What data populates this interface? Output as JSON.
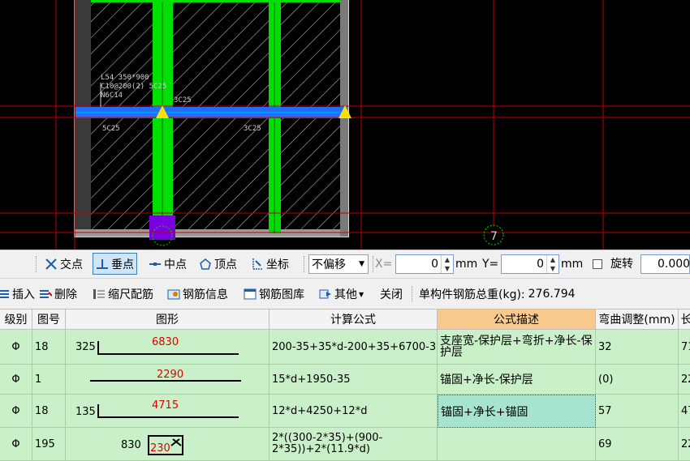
{
  "cad": {
    "beam_label_lines": [
      "L54 350*900",
      "C10@200(2) 5C25",
      "N6C14"
    ],
    "rebar_labels": [
      "3C25",
      "5C25",
      "3C25"
    ],
    "axis_label": "7"
  },
  "snap_toolbar": {
    "intersection": "交点",
    "perpendicular": "垂点",
    "midpoint": "中点",
    "vertex": "顶点",
    "coordinate": "坐标",
    "offset_mode": "不偏移",
    "x_label": "X=",
    "x_value": "0",
    "x_unit": "mm",
    "y_label": "Y=",
    "y_value": "0",
    "y_unit": "mm",
    "rotate_label": "旋转",
    "rotate_value": "0.000"
  },
  "rebar_toolbar": {
    "insert": "插入",
    "delete": "删除",
    "scale_rebar": "缩尺配筋",
    "rebar_info": "钢筋信息",
    "rebar_library": "钢筋图库",
    "other": "其他",
    "close": "关闭",
    "total_weight_label": "单构件钢筋总重(kg):",
    "total_weight_value": "276.794"
  },
  "table": {
    "columns": [
      "级别",
      "图号",
      "图形",
      "计算公式",
      "公式描述",
      "弯曲调整(mm)",
      "长"
    ],
    "selected_column": "公式描述",
    "rows": [
      {
        "grade": "Φ",
        "fig": "18",
        "shape_left": "325",
        "shape_len": "6830",
        "formula": "200-35+35*d-200+35+6700-35",
        "desc": "支座宽-保护层+弯折+净长-保护层",
        "bend": "32",
        "long": "71"
      },
      {
        "grade": "Φ",
        "fig": "1",
        "shape_left": "",
        "shape_len": "2290",
        "formula": "15*d+1950-35",
        "desc": "锚固+净长-保护层",
        "bend": "(0)",
        "long": "22"
      },
      {
        "grade": "Φ",
        "fig": "18",
        "shape_left": "135",
        "shape_len": "4715",
        "formula": "12*d+4250+12*d",
        "desc": "锚固+净长+锚固",
        "bend": "57",
        "long": "47"
      },
      {
        "grade": "Φ",
        "fig": "195",
        "shape_left": "830",
        "shape_len": "230",
        "formula": "2*((300-2*35)+(900-2*35))+2*(11.9*d)",
        "desc": "",
        "bend": "69",
        "long": "22"
      }
    ]
  },
  "colors": {
    "cad_bg": "#000000",
    "grid_line": "#c00000",
    "column_green": "#00e000",
    "beam_blue": "#1e6fff",
    "table_bg": "#c9f0c9",
    "selected_header": "#f8ca8e"
  }
}
